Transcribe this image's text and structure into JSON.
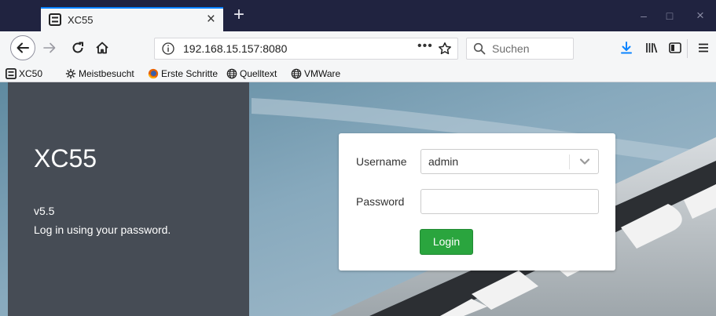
{
  "tab": {
    "title": "XC55",
    "close_glyph": "×",
    "new_tab_glyph": "+"
  },
  "window_controls": {
    "minimize": "–",
    "maximize": "□",
    "close": "×"
  },
  "navbar": {
    "url": "192.168.15.157:8080",
    "page_actions": "•••",
    "search_placeholder": "Suchen"
  },
  "bookmarks": [
    {
      "label": "XC50",
      "icon": "xc-logo-icon"
    },
    {
      "label": "Meistbesucht",
      "icon": "gear-icon"
    },
    {
      "label": "Erste Schritte",
      "icon": "firefox-icon"
    },
    {
      "label": "Quelltext",
      "icon": "globe-icon"
    },
    {
      "label": "VMWare",
      "icon": "globe-icon"
    }
  ],
  "left_panel": {
    "brand": "XC55",
    "version": "v5.5",
    "hint": "Log in using your password."
  },
  "login": {
    "username_label": "Username",
    "username_value": "admin",
    "password_label": "Password",
    "password_value": "",
    "button_label": "Login"
  },
  "colors": {
    "tabbar": "#202340",
    "accent": "#0a84ff",
    "panel": "#464c55",
    "login_button": "#2aa53e",
    "download": "#0a84ff"
  }
}
